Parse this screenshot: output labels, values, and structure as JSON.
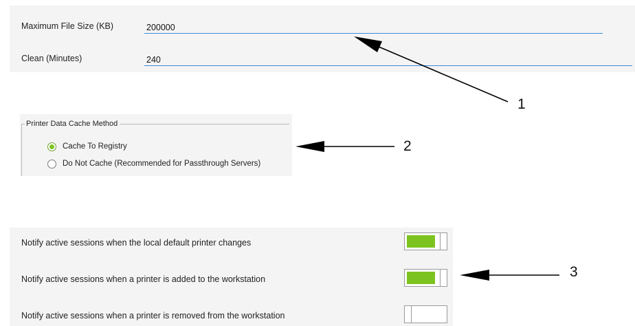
{
  "settings": {
    "max_file_size": {
      "label": "Maximum File Size (KB)",
      "value": "200000"
    },
    "clean_minutes": {
      "label": "Clean (Minutes)",
      "value": "240"
    }
  },
  "cache_method": {
    "legend": "Printer Data Cache Method",
    "options": [
      {
        "label": "Cache To Registry",
        "selected": true
      },
      {
        "label": "Do Not Cache (Recommended for Passthrough Servers)",
        "selected": false
      }
    ]
  },
  "notifications": [
    {
      "label": "Notify active sessions when the local default printer changes",
      "enabled": true
    },
    {
      "label": "Notify active sessions when a printer is added to the workstation",
      "enabled": true
    },
    {
      "label": "Notify active sessions when a printer is removed from the workstation",
      "enabled": false
    }
  ],
  "callouts": [
    "1",
    "2",
    "3"
  ],
  "colors": {
    "toggle_on": "#7dc31f",
    "input_underline": "#3c8ad8",
    "panel_background": "#f4f4f4"
  }
}
